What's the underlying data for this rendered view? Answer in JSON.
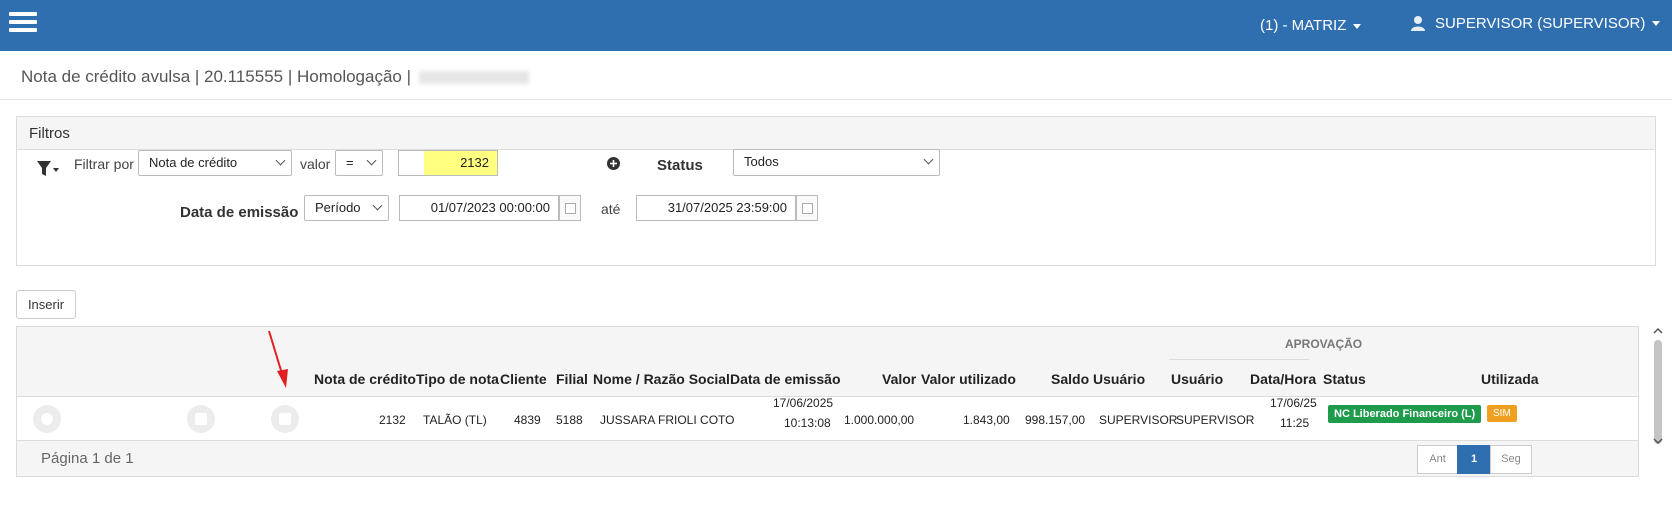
{
  "topbar": {
    "branch": "(1) - MATRIZ",
    "user": "SUPERVISOR (SUPERVISOR)",
    "color": "#2f6fb0"
  },
  "breadcrumb": "Nota de crédito avulsa | 20.115555 | Homologação |",
  "filters": {
    "title": "Filtros",
    "filter_by_label": "Filtrar por",
    "filter_by_value": "Nota de crédito",
    "valor_label": "valor",
    "operator": "=",
    "value": "2132",
    "status_label": "Status",
    "status_value": "Todos",
    "emission_label": "Data de emissão",
    "period_value": "Período",
    "date_from": "01/07/2023 00:00:00",
    "ate_label": "até",
    "date_to": "31/07/2025 23:59:00"
  },
  "insert_button": "Inserir",
  "grid": {
    "group_header": "APROVAÇÃO",
    "columns": [
      "Nota de crédito",
      "Tipo de nota",
      "Cliente",
      "Filial",
      "Nome / Razão Social",
      "Data de emissão",
      "Valor",
      "Valor utilizado",
      "Saldo",
      "Usuário",
      "Usuário",
      "Data/Hora",
      "Status",
      "Utilizada"
    ],
    "row": {
      "nota": "2132",
      "tipo": "TALÃO (TL)",
      "cliente": "4839",
      "filial": "5188",
      "nome": "JUSSARA FRIOLI COTO",
      "data_emissao_date": "17/06/2025",
      "data_emissao_time": "10:13:08",
      "valor": "1.000.000,00",
      "valor_utilizado": "1.843,00",
      "saldo": "998.157,00",
      "usuario": "SUPERVISOR",
      "aprov_usuario": "SUPERVISOR",
      "aprov_date": "17/06/25",
      "aprov_time": "11:25",
      "status": "NC Liberado Financeiro (L)",
      "utilizada": "SIM"
    },
    "pagination": {
      "page_info": "Página 1 de 1",
      "prev": "Ant",
      "current": "1",
      "next": "Seg"
    }
  }
}
